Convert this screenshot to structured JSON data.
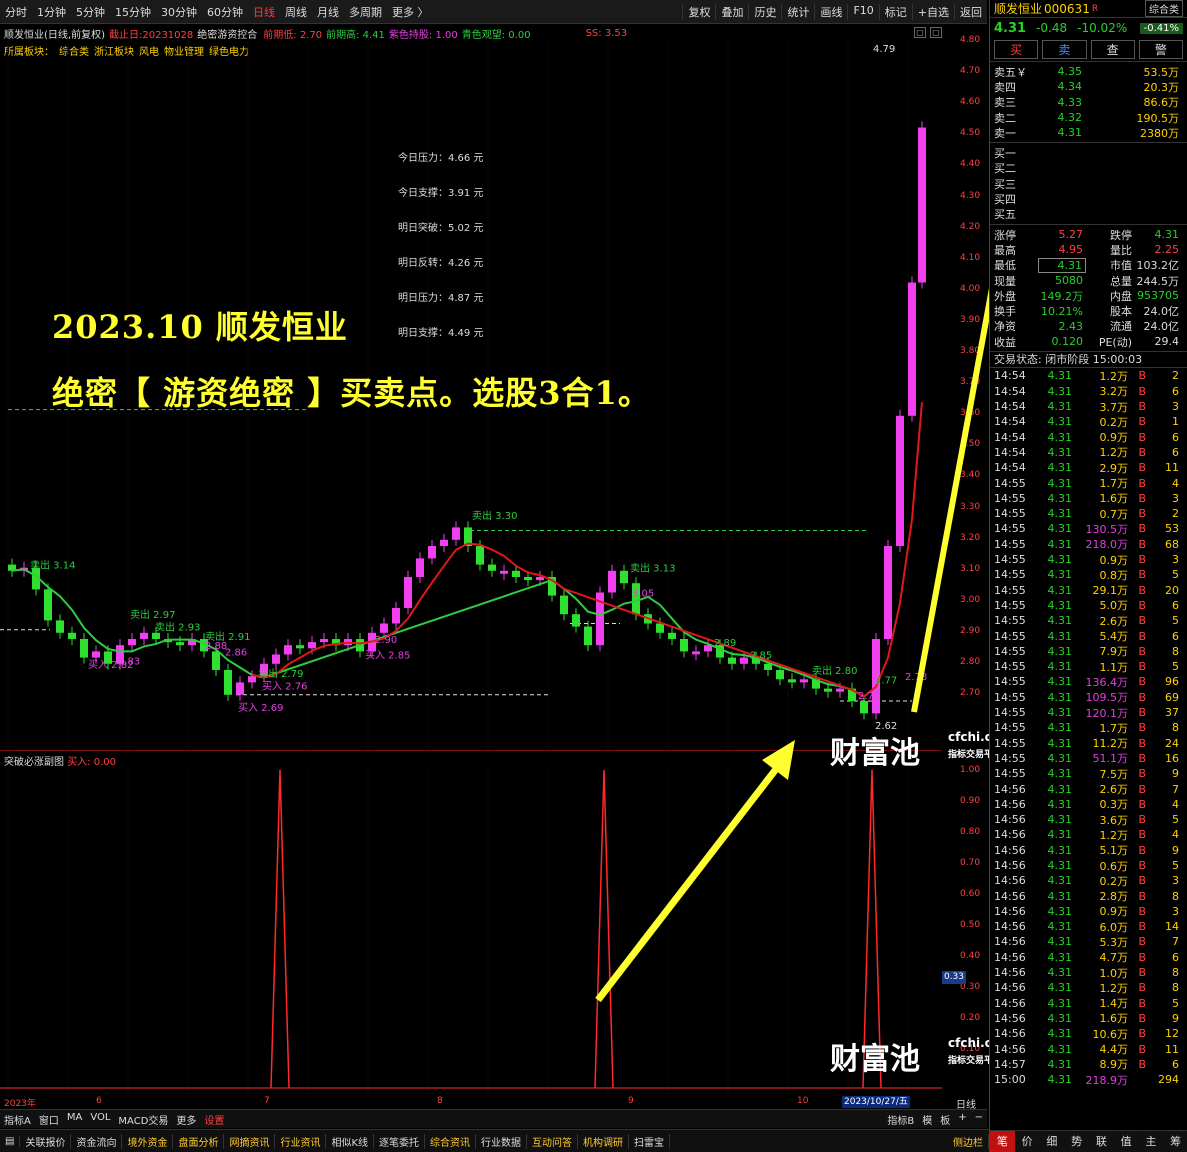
{
  "toolbar": {
    "periods": [
      "分时",
      "1分钟",
      "5分钟",
      "15分钟",
      "30分钟",
      "60分钟",
      "日线",
      "周线",
      "月线",
      "多周期",
      "更多 〉"
    ],
    "active": "日线",
    "right": [
      "复权",
      "叠加",
      "历史",
      "统计",
      "画线",
      "F10",
      "标记",
      "+自选",
      "返回"
    ]
  },
  "info": {
    "title": "顺发恒业(日线,前复权)",
    "date": "截止日:20231028",
    "indicator": "绝密游资控合",
    "f1": "前期低: 2.70",
    "f2": "前期高: 4.41",
    "f3": "紫色持股: 1.00",
    "f4": "青色观望: 0.00",
    "ss": "SS: 3.53",
    "sector_label": "所属板块：",
    "sectors": [
      "综合类",
      "浙江板块",
      "风电",
      "物业管理",
      "绿色电力"
    ]
  },
  "levels": [
    "今日压力：4.66 元",
    "今日支撑：3.91 元",
    "明日突破：5.02 元",
    "明日反转：4.26 元",
    "明日压力：4.87 元",
    "明日支撑：4.49 元"
  ],
  "headline": {
    "line1": "2023.10 顺发恒业",
    "line2": "绝密【 游资绝密 】买卖点。选股3合1。"
  },
  "yaxis": [
    "4.80",
    "4.70",
    "4.60",
    "4.50",
    "4.40",
    "4.30",
    "4.20",
    "4.10",
    "4.00",
    "3.90",
    "3.80",
    "3.70",
    "3.60",
    "3.50",
    "3.40",
    "3.30",
    "3.20",
    "3.10",
    "3.00",
    "2.90",
    "2.80",
    "2.70"
  ],
  "sub_axis": [
    "1.00",
    "0.90",
    "0.80",
    "0.70",
    "0.60",
    "0.50",
    "0.40",
    "0.30",
    "0.20",
    "0.10"
  ],
  "sub_hi": "0.33",
  "sub_title": "突破必涨副图",
  "sub_val": "买入: 0.00",
  "xaxis": [
    "2023年",
    "6",
    "7",
    "8",
    "9",
    "10"
  ],
  "date_hi": "2023/10/27/五",
  "period_lbl": "日线",
  "chart_data": {
    "type": "candlestick",
    "hi_mark": "4.79",
    "lo_mark": "2.62",
    "annotations": [
      {
        "t": "卖出 3.14",
        "c": "#2ecc40"
      },
      {
        "t": "卖出 2.97",
        "c": "#2ecc40"
      },
      {
        "t": "卖出 2.93",
        "c": "#2ecc40"
      },
      {
        "t": "卖出 2.91",
        "c": "#2ecc40"
      },
      {
        "t": "买入 2.82",
        "c": "#e040e0"
      },
      {
        "t": "2.83",
        "c": "#e040e0"
      },
      {
        "t": "2.88",
        "c": "#e040e0"
      },
      {
        "t": "2.86",
        "c": "#e040e0"
      },
      {
        "t": "卖出 2.79",
        "c": "#2ecc40"
      },
      {
        "t": "买入 2.76",
        "c": "#e040e0"
      },
      {
        "t": "买入 2.69",
        "c": "#e040e0"
      },
      {
        "t": "2.90",
        "c": "#e040e0"
      },
      {
        "t": "买入 2.85",
        "c": "#e040e0"
      },
      {
        "t": "卖出 3.30",
        "c": "#2ecc40"
      },
      {
        "t": "卖出 3.13",
        "c": "#2ecc40"
      },
      {
        "t": "3.05",
        "c": "#e040e0"
      },
      {
        "t": "2.89",
        "c": "#2ecc40"
      },
      {
        "t": "2.85",
        "c": "#2ecc40"
      },
      {
        "t": "卖出 2.80",
        "c": "#2ecc40"
      },
      {
        "t": "2.77",
        "c": "#2ecc40"
      },
      {
        "t": "2.78",
        "c": "#e040e0"
      },
      {
        "t": "2.72",
        "c": "#e040e0"
      }
    ],
    "sub_series": [
      {
        "name": "买入",
        "values": [
          1,
          1,
          1
        ]
      }
    ]
  },
  "watermark": {
    "logo": "财富池",
    "site": "cfchi.com",
    "sub": "指标交易平台"
  },
  "bottom_tabs": [
    "指标A",
    "窗口",
    "MA",
    "VOL",
    "MACD交易",
    "更多",
    "设置"
  ],
  "bottom_right": [
    "指标B",
    "模",
    "板",
    "+",
    "−"
  ],
  "footer": [
    "关联报价",
    "资金流向",
    "境外资金",
    "盘面分析",
    "网摘资讯",
    "行业资讯",
    "相似K线",
    "逐笔委托",
    "综合资讯",
    "行业数据",
    "互动问答",
    "机构调研",
    "扫雷宝"
  ],
  "footer_side": "侧边栏",
  "quote": {
    "name": "顺发恒业",
    "code": "000631",
    "flag": "R",
    "tag": "综合类",
    "price": "4.31",
    "chg": "-0.48",
    "pct": "-10.02%",
    "sector_pct": "-0.41%",
    "actions": [
      "买",
      "卖",
      "查",
      "警"
    ],
    "asks": [
      [
        "卖五￥",
        "4.35",
        "53.5万"
      ],
      [
        "卖四",
        "4.34",
        "20.3万"
      ],
      [
        "卖三",
        "4.33",
        "86.6万"
      ],
      [
        "卖二",
        "4.32",
        "190.5万"
      ],
      [
        "卖一",
        "4.31",
        "2380万"
      ]
    ],
    "bids": [
      "买一",
      "买二",
      "买三",
      "买四",
      "买五"
    ],
    "stats": [
      [
        "涨停",
        "5.27",
        "跌停",
        "4.31"
      ],
      [
        "最高",
        "4.95",
        "量比",
        "2.25"
      ],
      [
        "最低",
        "4.31",
        "市值",
        "103.2亿"
      ],
      [
        "现量",
        "5080",
        "总量",
        "244.5万"
      ],
      [
        "外盘",
        "149.2万",
        "内盘",
        "953705"
      ],
      [
        "换手",
        "10.21%",
        "股本",
        "24.0亿"
      ],
      [
        "净资",
        "2.43",
        "流通",
        "24.0亿"
      ],
      [
        "收益",
        "0.120",
        "PE(动)",
        "29.4"
      ]
    ],
    "status": "交易状态: 闭市阶段 15:00:03",
    "ticks": [
      [
        "14:54",
        "4.31",
        "1.2万",
        "B",
        "2"
      ],
      [
        "14:54",
        "4.31",
        "3.2万",
        "B",
        "6"
      ],
      [
        "14:54",
        "4.31",
        "3.7万",
        "B",
        "3"
      ],
      [
        "14:54",
        "4.31",
        "0.2万",
        "B",
        "1"
      ],
      [
        "14:54",
        "4.31",
        "0.9万",
        "B",
        "6"
      ],
      [
        "14:54",
        "4.31",
        "1.2万",
        "B",
        "6"
      ],
      [
        "14:54",
        "4.31",
        "2.9万",
        "B",
        "11"
      ],
      [
        "14:55",
        "4.31",
        "1.7万",
        "B",
        "4"
      ],
      [
        "14:55",
        "4.31",
        "1.6万",
        "B",
        "3"
      ],
      [
        "14:55",
        "4.31",
        "0.7万",
        "B",
        "2"
      ],
      [
        "14:55",
        "4.31",
        "130.5万",
        "B",
        "53"
      ],
      [
        "14:55",
        "4.31",
        "218.0万",
        "B",
        "68"
      ],
      [
        "14:55",
        "4.31",
        "0.9万",
        "B",
        "3"
      ],
      [
        "14:55",
        "4.31",
        "0.8万",
        "B",
        "5"
      ],
      [
        "14:55",
        "4.31",
        "29.1万",
        "B",
        "20"
      ],
      [
        "14:55",
        "4.31",
        "5.0万",
        "B",
        "6"
      ],
      [
        "14:55",
        "4.31",
        "2.6万",
        "B",
        "5"
      ],
      [
        "14:55",
        "4.31",
        "5.4万",
        "B",
        "6"
      ],
      [
        "14:55",
        "4.31",
        "7.9万",
        "B",
        "8"
      ],
      [
        "14:55",
        "4.31",
        "1.1万",
        "B",
        "5"
      ],
      [
        "14:55",
        "4.31",
        "136.4万",
        "B",
        "96"
      ],
      [
        "14:55",
        "4.31",
        "109.5万",
        "B",
        "69"
      ],
      [
        "14:55",
        "4.31",
        "120.1万",
        "B",
        "37"
      ],
      [
        "14:55",
        "4.31",
        "1.7万",
        "B",
        "8"
      ],
      [
        "14:55",
        "4.31",
        "11.2万",
        "B",
        "24"
      ],
      [
        "14:55",
        "4.31",
        "51.1万",
        "B",
        "16"
      ],
      [
        "14:55",
        "4.31",
        "7.5万",
        "B",
        "9"
      ],
      [
        "14:56",
        "4.31",
        "2.6万",
        "B",
        "7"
      ],
      [
        "14:56",
        "4.31",
        "0.3万",
        "B",
        "4"
      ],
      [
        "14:56",
        "4.31",
        "3.6万",
        "B",
        "5"
      ],
      [
        "14:56",
        "4.31",
        "1.2万",
        "B",
        "4"
      ],
      [
        "14:56",
        "4.31",
        "5.1万",
        "B",
        "9"
      ],
      [
        "14:56",
        "4.31",
        "0.6万",
        "B",
        "5"
      ],
      [
        "14:56",
        "4.31",
        "0.2万",
        "B",
        "3"
      ],
      [
        "14:56",
        "4.31",
        "2.8万",
        "B",
        "8"
      ],
      [
        "14:56",
        "4.31",
        "0.9万",
        "B",
        "3"
      ],
      [
        "14:56",
        "4.31",
        "6.0万",
        "B",
        "14"
      ],
      [
        "14:56",
        "4.31",
        "5.3万",
        "B",
        "7"
      ],
      [
        "14:56",
        "4.31",
        "4.7万",
        "B",
        "6"
      ],
      [
        "14:56",
        "4.31",
        "1.0万",
        "B",
        "8"
      ],
      [
        "14:56",
        "4.31",
        "1.2万",
        "B",
        "8"
      ],
      [
        "14:56",
        "4.31",
        "1.4万",
        "B",
        "5"
      ],
      [
        "14:56",
        "4.31",
        "1.6万",
        "B",
        "9"
      ],
      [
        "14:56",
        "4.31",
        "10.6万",
        "B",
        "12"
      ],
      [
        "14:56",
        "4.31",
        "4.4万",
        "B",
        "11"
      ],
      [
        "14:57",
        "4.31",
        "8.9万",
        "B",
        "6"
      ],
      [
        "15:00",
        "4.31",
        "218.9万",
        "",
        "294"
      ]
    ],
    "tabs": [
      "笔",
      "价",
      "细",
      "势",
      "联",
      "值",
      "主",
      "筹"
    ]
  }
}
